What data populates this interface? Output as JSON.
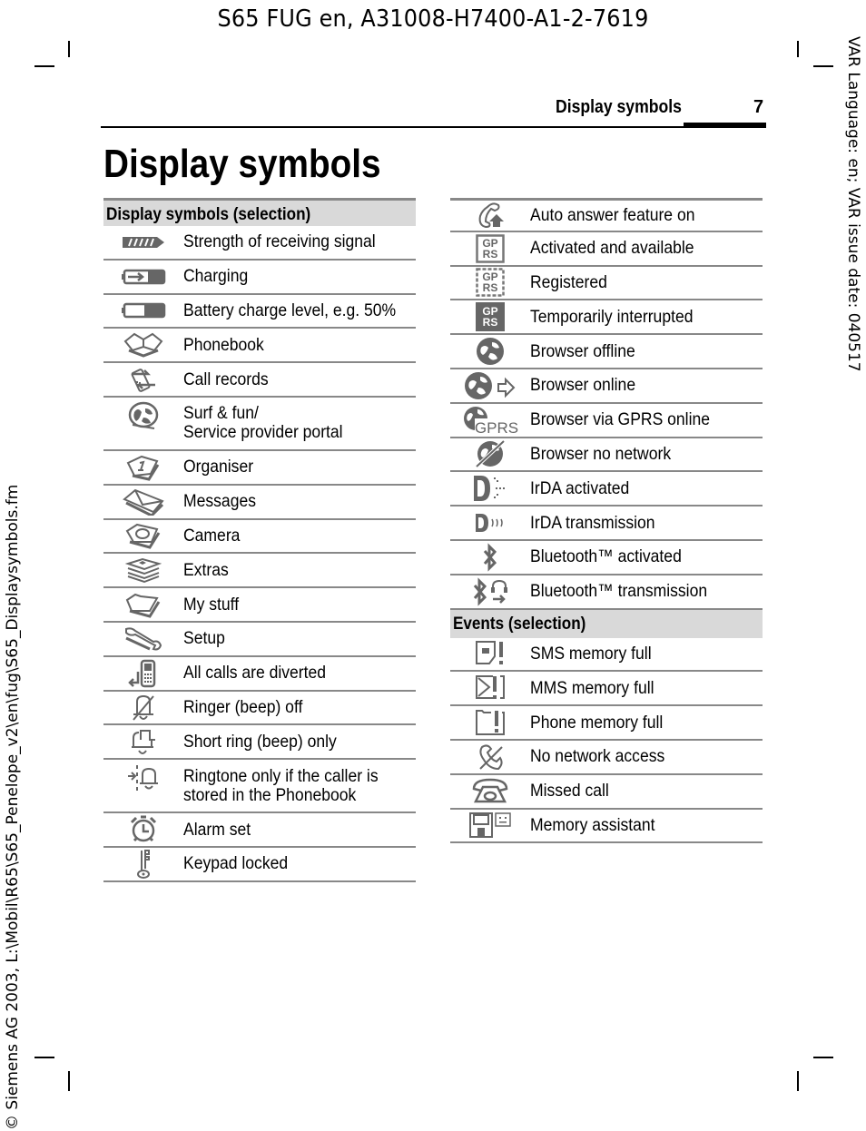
{
  "document": {
    "doc_id": "S65 FUG en, A31008-H7400-A1-2-7619",
    "side_left": "© Siemens AG 2003, L:\\Mobil\\R65\\S65_Penelope_v2\\en\\fug\\S65_Displaysymbols.fm",
    "side_right": "VAR Language: en; VAR issue date: 040517",
    "running_head": "Display symbols",
    "page_number": "7",
    "title": "Display symbols"
  },
  "left_table": {
    "heading": "Display symbols (selection)",
    "rows": [
      {
        "icon": "signal-strength-icon",
        "label": "Strength of receiving signal"
      },
      {
        "icon": "charging-icon",
        "label": "Charging"
      },
      {
        "icon": "battery-icon",
        "label": "Battery charge level, e.g. 50%"
      },
      {
        "icon": "phonebook-icon",
        "label": "Phonebook"
      },
      {
        "icon": "call-records-icon",
        "label": "Call records"
      },
      {
        "icon": "surf-fun-icon",
        "label": "Surf & fun/",
        "label2": "Service provider portal"
      },
      {
        "icon": "organiser-icon",
        "label": "Organiser"
      },
      {
        "icon": "messages-icon",
        "label": "Messages"
      },
      {
        "icon": "camera-icon",
        "label": "Camera"
      },
      {
        "icon": "extras-icon",
        "label": "Extras"
      },
      {
        "icon": "my-stuff-icon",
        "label": "My stuff"
      },
      {
        "icon": "setup-icon",
        "label": "Setup"
      },
      {
        "icon": "call-divert-icon",
        "label": "All calls are diverted"
      },
      {
        "icon": "ringer-off-icon",
        "label": "Ringer (beep) off"
      },
      {
        "icon": "short-ring-icon",
        "label": "Short ring (beep) only"
      },
      {
        "icon": "ringtone-phonebook-icon",
        "label": "Ringtone only if the caller is",
        "label2": "stored in the Phonebook"
      },
      {
        "icon": "alarm-icon",
        "label": "Alarm set"
      },
      {
        "icon": "key-icon",
        "label": "Keypad locked"
      }
    ]
  },
  "right_table": {
    "rows": [
      {
        "icon": "auto-answer-icon",
        "label": "Auto answer feature on"
      },
      {
        "icon": "gprs-available-icon",
        "label": "Activated and available",
        "icon_text": [
          "GP",
          "RS"
        ]
      },
      {
        "icon": "gprs-registered-icon",
        "label": "Registered",
        "icon_text": [
          "GP",
          "RS"
        ]
      },
      {
        "icon": "gprs-interrupted-icon",
        "label": "Temporarily interrupted",
        "icon_text": [
          "GP",
          "RS"
        ]
      },
      {
        "icon": "browser-offline-icon",
        "label": "Browser offline"
      },
      {
        "icon": "browser-online-icon",
        "label": "Browser online"
      },
      {
        "icon": "browser-gprs-icon",
        "label": "Browser via GPRS online",
        "icon_text": [
          "GPRS"
        ]
      },
      {
        "icon": "browser-no-network-icon",
        "label": "Browser no network"
      },
      {
        "icon": "irda-activated-icon",
        "label": "IrDA activated"
      },
      {
        "icon": "irda-transmission-icon",
        "label": "IrDA transmission"
      },
      {
        "icon": "bluetooth-icon",
        "label": "Bluetooth™ activated"
      },
      {
        "icon": "bluetooth-transmission-icon",
        "label": "Bluetooth™ transmission"
      }
    ],
    "events_heading": "Events (selection)",
    "events": [
      {
        "icon": "sms-full-icon",
        "label": "SMS memory full"
      },
      {
        "icon": "mms-full-icon",
        "label": "MMS memory full"
      },
      {
        "icon": "phone-memory-full-icon",
        "label": "Phone memory full"
      },
      {
        "icon": "no-network-icon",
        "label": "No network access"
      },
      {
        "icon": "missed-call-icon",
        "label": "Missed call"
      },
      {
        "icon": "memory-assistant-icon",
        "label": "Memory assistant"
      }
    ]
  }
}
